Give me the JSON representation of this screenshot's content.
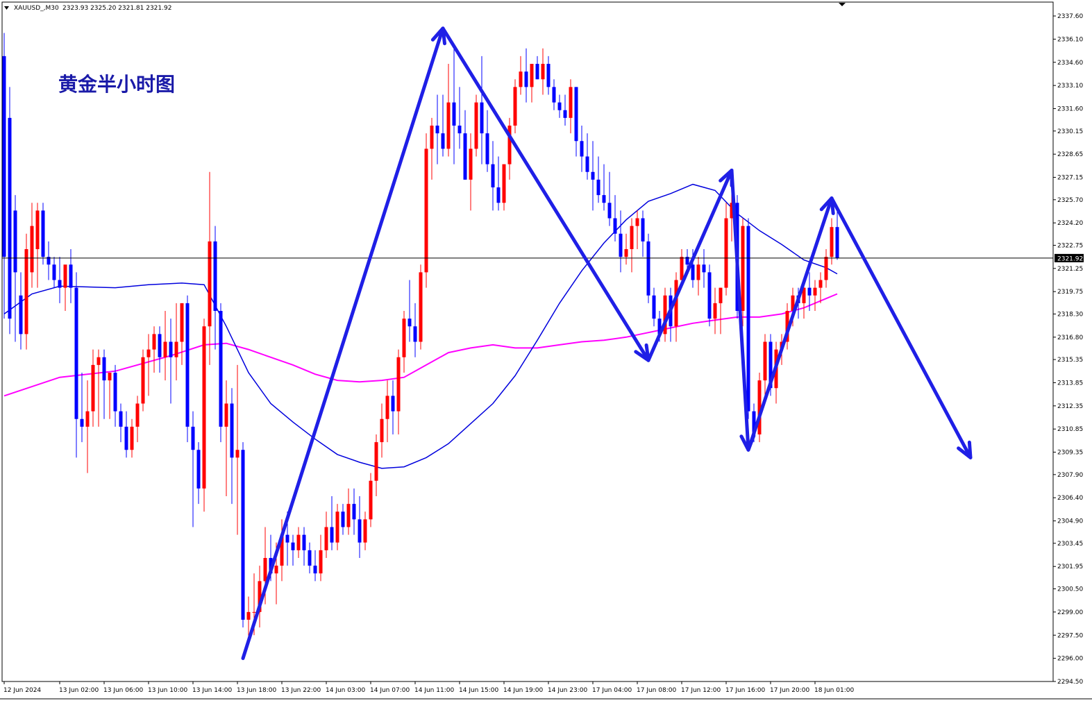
{
  "header": {
    "symbol": "XAUUSD_,M30",
    "ohlc": "2323.93 2325.20 2321.81 2321.92"
  },
  "title": "黄金半小时图",
  "current_price": "2321.92",
  "colors": {
    "up": "#ff0000",
    "down": "#0000ff",
    "ma_fast": "#0000dd",
    "ma_slow": "#ff00ff",
    "arrow": "#1f1fe6",
    "title": "#1a1aa8",
    "price_line": "#000000",
    "price_tag_bg": "#000000"
  },
  "chart_data": {
    "type": "candlestick",
    "ylim": [
      2294.5,
      2338.5
    ],
    "y_ticks": [
      "2337.60",
      "2336.10",
      "2334.60",
      "2333.10",
      "2331.60",
      "2330.15",
      "2328.65",
      "2327.15",
      "2325.70",
      "2324.20",
      "2322.75",
      "2321.25",
      "2319.75",
      "2318.30",
      "2316.80",
      "2315.35",
      "2313.85",
      "2312.35",
      "2310.85",
      "2309.35",
      "2307.90",
      "2306.40",
      "2304.90",
      "2303.45",
      "2301.95",
      "2300.50",
      "2299.00",
      "2297.50",
      "2296.00",
      "2294.50"
    ],
    "x_ticks": [
      {
        "label": "12 Jun 2024",
        "i": 0
      },
      {
        "label": "13 Jun 02:00",
        "i": 10
      },
      {
        "label": "13 Jun 06:00",
        "i": 18
      },
      {
        "label": "13 Jun 10:00",
        "i": 26
      },
      {
        "label": "13 Jun 14:00",
        "i": 34
      },
      {
        "label": "13 Jun 18:00",
        "i": 42
      },
      {
        "label": "13 Jun 22:00",
        "i": 50
      },
      {
        "label": "14 Jun 03:00",
        "i": 58
      },
      {
        "label": "14 Jun 07:00",
        "i": 66
      },
      {
        "label": "14 Jun 11:00",
        "i": 74
      },
      {
        "label": "14 Jun 15:00",
        "i": 82
      },
      {
        "label": "14 Jun 19:00",
        "i": 90
      },
      {
        "label": "14 Jun 23:00",
        "i": 98
      },
      {
        "label": "17 Jun 04:00",
        "i": 106
      },
      {
        "label": "17 Jun 08:00",
        "i": 114
      },
      {
        "label": "17 Jun 12:00",
        "i": 122
      },
      {
        "label": "17 Jun 16:00",
        "i": 130
      },
      {
        "label": "17 Jun 20:00",
        "i": 138
      },
      {
        "label": "18 Jun 01:00",
        "i": 146
      }
    ],
    "candles": [
      [
        2335.0,
        2336.5,
        2318.0,
        2322.0
      ],
      [
        2331.0,
        2333.0,
        2317.0,
        2318.0
      ],
      [
        2325.0,
        2326.0,
        2316.5,
        2321.0
      ],
      [
        2319.5,
        2321.0,
        2316.0,
        2317.0
      ],
      [
        2317.0,
        2323.5,
        2316.0,
        2322.5
      ],
      [
        2321.0,
        2325.5,
        2320.0,
        2324.0
      ],
      [
        2322.5,
        2325.5,
        2320.0,
        2325.0
      ],
      [
        2325.0,
        2325.5,
        2321.5,
        2322.0
      ],
      [
        2322.0,
        2323.0,
        2320.5,
        2321.5
      ],
      [
        2321.5,
        2322.0,
        2320.0,
        2320.5
      ],
      [
        2320.5,
        2322.0,
        2319.0,
        2320.0
      ],
      [
        2320.0,
        2321.0,
        2318.5,
        2321.5
      ],
      [
        2321.5,
        2322.5,
        2319.0,
        2320.0
      ],
      [
        2320.0,
        2321.0,
        2309.0,
        2311.5
      ],
      [
        2311.5,
        2314.5,
        2310.0,
        2311.0
      ],
      [
        2311.0,
        2314.0,
        2308.0,
        2312.0
      ],
      [
        2312.0,
        2316.0,
        2311.0,
        2315.0
      ],
      [
        2315.0,
        2316.0,
        2311.0,
        2315.5
      ],
      [
        2315.5,
        2316.0,
        2311.5,
        2314.0
      ],
      [
        2314.0,
        2314.5,
        2311.5,
        2314.5
      ],
      [
        2314.5,
        2315.0,
        2311.0,
        2312.0
      ],
      [
        2312.0,
        2312.5,
        2310.0,
        2311.0
      ],
      [
        2311.0,
        2312.0,
        2309.0,
        2309.5
      ],
      [
        2309.5,
        2311.5,
        2309.0,
        2311.0
      ],
      [
        2311.0,
        2313.0,
        2310.0,
        2312.5
      ],
      [
        2312.5,
        2316.0,
        2312.0,
        2315.5
      ],
      [
        2315.5,
        2317.0,
        2313.0,
        2316.0
      ],
      [
        2316.0,
        2317.5,
        2314.5,
        2317.0
      ],
      [
        2317.0,
        2317.5,
        2314.5,
        2315.5
      ],
      [
        2315.5,
        2318.5,
        2314.0,
        2316.5
      ],
      [
        2316.5,
        2318.0,
        2312.5,
        2315.5
      ],
      [
        2315.5,
        2319.0,
        2314.0,
        2316.5
      ],
      [
        2316.5,
        2318.5,
        2315.0,
        2319.0
      ],
      [
        2319.0,
        2319.5,
        2310.0,
        2311.0
      ],
      [
        2311.0,
        2312.0,
        2304.5,
        2309.5
      ],
      [
        2309.5,
        2310.0,
        2306.0,
        2307.0
      ],
      [
        2307.0,
        2318.0,
        2305.5,
        2317.5
      ],
      [
        2317.5,
        2327.5,
        2315.0,
        2323.0
      ],
      [
        2323.0,
        2324.0,
        2316.0,
        2318.5
      ],
      [
        2318.5,
        2319.0,
        2310.0,
        2311.0
      ],
      [
        2311.0,
        2314.0,
        2306.5,
        2312.5
      ],
      [
        2312.5,
        2313.5,
        2306.0,
        2309.0
      ],
      [
        2309.0,
        2315.0,
        2304.0,
        2309.5
      ],
      [
        2309.5,
        2310.0,
        2298.0,
        2298.5
      ],
      [
        2298.5,
        2300.0,
        2297.0,
        2299.0
      ],
      [
        2299.0,
        2301.5,
        2297.5,
        2299.0
      ],
      [
        2299.0,
        2302.0,
        2298.0,
        2301.0
      ],
      [
        2301.0,
        2304.5,
        2299.5,
        2302.5
      ],
      [
        2302.5,
        2304.0,
        2301.0,
        2301.5
      ],
      [
        2301.5,
        2303.5,
        2299.5,
        2302.0
      ],
      [
        2302.0,
        2305.0,
        2301.0,
        2304.0
      ],
      [
        2304.0,
        2305.5,
        2302.0,
        2303.5
      ],
      [
        2303.5,
        2304.0,
        2302.0,
        2303.0
      ],
      [
        2303.0,
        2304.5,
        2302.5,
        2304.0
      ],
      [
        2304.0,
        2304.5,
        2302.0,
        2303.0
      ],
      [
        2303.0,
        2303.5,
        2301.5,
        2302.0
      ],
      [
        2302.0,
        2303.0,
        2301.0,
        2301.5
      ],
      [
        2301.5,
        2304.0,
        2301.0,
        2303.0
      ],
      [
        2303.0,
        2305.5,
        2302.5,
        2304.5
      ],
      [
        2304.5,
        2306.5,
        2303.0,
        2303.5
      ],
      [
        2303.5,
        2306.0,
        2303.0,
        2305.5
      ],
      [
        2305.5,
        2306.0,
        2304.0,
        2304.5
      ],
      [
        2304.5,
        2307.0,
        2304.0,
        2306.0
      ],
      [
        2306.0,
        2307.0,
        2304.0,
        2305.0
      ],
      [
        2305.0,
        2306.5,
        2302.5,
        2303.5
      ],
      [
        2303.5,
        2305.5,
        2303.0,
        2305.0
      ],
      [
        2305.0,
        2308.0,
        2304.5,
        2307.5
      ],
      [
        2307.5,
        2310.5,
        2306.5,
        2310.0
      ],
      [
        2310.0,
        2312.5,
        2309.0,
        2311.5
      ],
      [
        2311.5,
        2314.0,
        2310.0,
        2313.0
      ],
      [
        2313.0,
        2314.0,
        2310.5,
        2312.0
      ],
      [
        2312.0,
        2316.0,
        2310.5,
        2315.5
      ],
      [
        2315.5,
        2318.5,
        2314.5,
        2318.0
      ],
      [
        2318.0,
        2320.5,
        2316.5,
        2317.5
      ],
      [
        2317.5,
        2319.0,
        2315.5,
        2316.5
      ],
      [
        2316.5,
        2321.5,
        2316.0,
        2321.0
      ],
      [
        2321.0,
        2330.0,
        2320.0,
        2329.0
      ],
      [
        2329.0,
        2331.0,
        2327.0,
        2330.5
      ],
      [
        2330.5,
        2332.5,
        2328.0,
        2330.0
      ],
      [
        2330.0,
        2332.5,
        2328.5,
        2329.0
      ],
      [
        2329.0,
        2334.5,
        2328.5,
        2332.0
      ],
      [
        2332.0,
        2335.5,
        2328.0,
        2330.5
      ],
      [
        2330.5,
        2333.0,
        2329.0,
        2330.0
      ],
      [
        2330.0,
        2331.5,
        2327.0,
        2327.0
      ],
      [
        2327.0,
        2330.0,
        2325.0,
        2329.0
      ],
      [
        2329.0,
        2332.5,
        2328.5,
        2332.0
      ],
      [
        2332.0,
        2335.0,
        2328.0,
        2330.0
      ],
      [
        2330.0,
        2331.5,
        2327.5,
        2328.0
      ],
      [
        2328.0,
        2329.5,
        2325.0,
        2326.5
      ],
      [
        2326.5,
        2328.5,
        2325.0,
        2325.5
      ],
      [
        2325.5,
        2327.5,
        2325.0,
        2328.0
      ],
      [
        2328.0,
        2331.0,
        2327.0,
        2330.5
      ],
      [
        2330.5,
        2333.5,
        2330.0,
        2333.0
      ],
      [
        2333.0,
        2335.0,
        2332.5,
        2334.0
      ],
      [
        2334.0,
        2335.5,
        2332.0,
        2333.0
      ],
      [
        2333.0,
        2334.5,
        2332.0,
        2334.5
      ],
      [
        2334.5,
        2335.0,
        2333.5,
        2333.5
      ],
      [
        2333.5,
        2335.5,
        2332.5,
        2334.5
      ],
      [
        2334.5,
        2335.0,
        2332.5,
        2333.0
      ],
      [
        2333.0,
        2333.5,
        2331.5,
        2332.0
      ],
      [
        2332.0,
        2332.5,
        2331.0,
        2331.5
      ],
      [
        2331.5,
        2332.5,
        2330.5,
        2331.0
      ],
      [
        2331.0,
        2333.5,
        2330.0,
        2333.0
      ],
      [
        2333.0,
        2333.0,
        2328.5,
        2329.5
      ],
      [
        2329.5,
        2330.5,
        2327.5,
        2328.5
      ],
      [
        2328.5,
        2330.0,
        2327.0,
        2327.5
      ],
      [
        2327.5,
        2329.5,
        2325.0,
        2327.0
      ],
      [
        2327.0,
        2328.5,
        2325.5,
        2326.0
      ],
      [
        2326.0,
        2328.0,
        2325.0,
        2325.5
      ],
      [
        2325.5,
        2327.5,
        2324.0,
        2324.5
      ],
      [
        2324.5,
        2326.0,
        2323.0,
        2323.5
      ],
      [
        2323.5,
        2325.0,
        2321.0,
        2322.0
      ],
      [
        2322.0,
        2323.5,
        2321.5,
        2322.5
      ],
      [
        2322.5,
        2324.5,
        2321.0,
        2324.0
      ],
      [
        2324.0,
        2325.0,
        2322.5,
        2324.5
      ],
      [
        2324.5,
        2325.0,
        2322.0,
        2323.0
      ],
      [
        2323.0,
        2323.5,
        2319.0,
        2319.5
      ],
      [
        2319.5,
        2320.0,
        2317.5,
        2318.0
      ],
      [
        2318.0,
        2318.5,
        2316.5,
        2317.0
      ],
      [
        2317.0,
        2320.0,
        2316.5,
        2319.5
      ],
      [
        2319.5,
        2320.0,
        2316.5,
        2317.5
      ],
      [
        2317.5,
        2321.0,
        2316.5,
        2320.5
      ],
      [
        2320.5,
        2322.5,
        2320.0,
        2322.0
      ],
      [
        2322.0,
        2322.5,
        2321.0,
        2321.5
      ],
      [
        2321.5,
        2322.5,
        2320.0,
        2320.5
      ],
      [
        2320.5,
        2322.0,
        2319.5,
        2321.5
      ],
      [
        2321.5,
        2322.5,
        2320.0,
        2321.0
      ],
      [
        2321.0,
        2321.5,
        2317.5,
        2318.0
      ],
      [
        2318.0,
        2320.0,
        2317.0,
        2319.0
      ],
      [
        2319.0,
        2320.0,
        2317.0,
        2320.0
      ],
      [
        2320.0,
        2325.5,
        2319.5,
        2324.5
      ],
      [
        2324.5,
        2326.5,
        2323.0,
        2325.5
      ],
      [
        2325.5,
        2326.0,
        2318.0,
        2318.5
      ],
      [
        2318.5,
        2324.5,
        2317.5,
        2324.0
      ],
      [
        2324.0,
        2324.5,
        2311.5,
        2312.0
      ],
      [
        2312.0,
        2312.5,
        2310.0,
        2310.5
      ],
      [
        2310.5,
        2314.5,
        2310.0,
        2314.0
      ],
      [
        2314.0,
        2317.0,
        2313.0,
        2316.5
      ],
      [
        2316.5,
        2317.0,
        2313.0,
        2313.5
      ],
      [
        2313.5,
        2316.5,
        2312.5,
        2316.0
      ],
      [
        2316.0,
        2317.0,
        2315.0,
        2316.5
      ],
      [
        2316.5,
        2319.0,
        2316.0,
        2318.5
      ],
      [
        2318.5,
        2320.0,
        2317.5,
        2319.5
      ],
      [
        2319.5,
        2320.0,
        2318.0,
        2319.0
      ],
      [
        2319.0,
        2320.5,
        2318.0,
        2320.0
      ],
      [
        2320.0,
        2321.0,
        2318.5,
        2319.5
      ],
      [
        2319.5,
        2320.5,
        2318.5,
        2320.0
      ],
      [
        2320.0,
        2321.0,
        2319.0,
        2320.5
      ],
      [
        2320.5,
        2322.5,
        2320.0,
        2322.0
      ],
      [
        2322.0,
        2324.5,
        2321.5,
        2323.93
      ],
      [
        2323.93,
        2325.2,
        2321.81,
        2321.92
      ]
    ],
    "ma_fast": [
      [
        0,
        2318.3
      ],
      [
        5,
        2319.6
      ],
      [
        10,
        2320.1
      ],
      [
        20,
        2320.0
      ],
      [
        26,
        2320.2
      ],
      [
        32,
        2320.3
      ],
      [
        36,
        2320.2
      ],
      [
        40,
        2317.5
      ],
      [
        44,
        2314.5
      ],
      [
        48,
        2312.5
      ],
      [
        52,
        2311.3
      ],
      [
        56,
        2310.2
      ],
      [
        60,
        2309.2
      ],
      [
        64,
        2308.7
      ],
      [
        68,
        2308.3
      ],
      [
        72,
        2308.4
      ],
      [
        76,
        2309.0
      ],
      [
        80,
        2309.9
      ],
      [
        84,
        2311.2
      ],
      [
        88,
        2312.5
      ],
      [
        92,
        2314.3
      ],
      [
        96,
        2316.6
      ],
      [
        100,
        2319.0
      ],
      [
        104,
        2321.1
      ],
      [
        108,
        2322.9
      ],
      [
        112,
        2324.4
      ],
      [
        116,
        2325.6
      ],
      [
        120,
        2326.1
      ],
      [
        124,
        2326.7
      ],
      [
        128,
        2326.3
      ],
      [
        132,
        2324.8
      ],
      [
        136,
        2323.7
      ],
      [
        140,
        2322.8
      ],
      [
        144,
        2321.8
      ],
      [
        148,
        2321.3
      ],
      [
        150,
        2320.9
      ]
    ],
    "ma_slow": [
      [
        0,
        2313.0
      ],
      [
        10,
        2314.2
      ],
      [
        20,
        2314.6
      ],
      [
        30,
        2315.6
      ],
      [
        36,
        2316.3
      ],
      [
        40,
        2316.4
      ],
      [
        44,
        2316.0
      ],
      [
        48,
        2315.5
      ],
      [
        52,
        2315.0
      ],
      [
        56,
        2314.4
      ],
      [
        60,
        2314.0
      ],
      [
        64,
        2313.9
      ],
      [
        68,
        2314.0
      ],
      [
        72,
        2314.2
      ],
      [
        76,
        2315.0
      ],
      [
        80,
        2315.8
      ],
      [
        84,
        2316.1
      ],
      [
        88,
        2316.3
      ],
      [
        92,
        2316.1
      ],
      [
        96,
        2316.1
      ],
      [
        100,
        2316.3
      ],
      [
        104,
        2316.5
      ],
      [
        108,
        2316.6
      ],
      [
        112,
        2316.8
      ],
      [
        116,
        2317.1
      ],
      [
        120,
        2317.4
      ],
      [
        124,
        2317.7
      ],
      [
        128,
        2317.9
      ],
      [
        132,
        2318.1
      ],
      [
        136,
        2318.1
      ],
      [
        140,
        2318.3
      ],
      [
        144,
        2318.7
      ],
      [
        148,
        2319.3
      ],
      [
        150,
        2319.6
      ]
    ],
    "annotations": [
      {
        "type": "arrow",
        "from": [
          43,
          2296.0
        ],
        "to": [
          79,
          2336.8
        ]
      },
      {
        "type": "arrow",
        "from": [
          79,
          2336.8
        ],
        "to": [
          116,
          2315.3
        ]
      },
      {
        "type": "arrow",
        "from": [
          116,
          2315.3
        ],
        "to": [
          131,
          2327.6
        ]
      },
      {
        "type": "arrow",
        "from": [
          131,
          2327.6
        ],
        "to": [
          134,
          2309.5
        ]
      },
      {
        "type": "arrow",
        "from": [
          134,
          2309.5
        ],
        "to": [
          149,
          2325.8
        ]
      },
      {
        "type": "arrow",
        "from": [
          149,
          2325.8
        ],
        "to": [
          174,
          2309.0
        ]
      }
    ]
  }
}
